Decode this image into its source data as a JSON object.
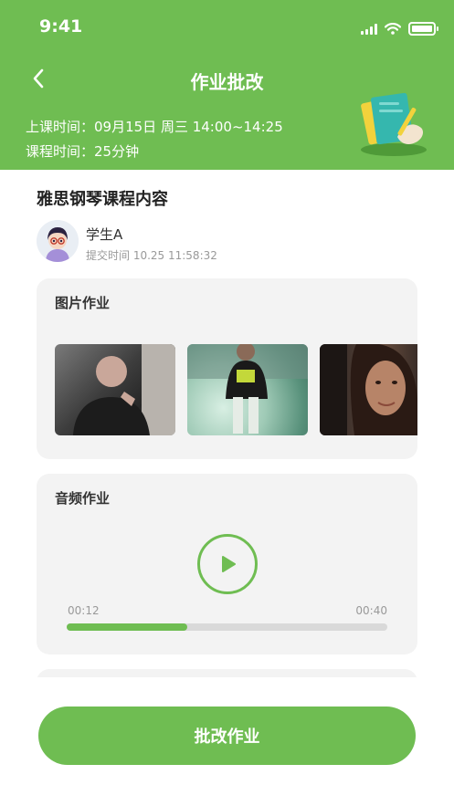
{
  "status_bar": {
    "time": "9:41"
  },
  "header": {
    "title": "作业批改",
    "class_time": "上课时间：09月15日 周三 14:00~14:25",
    "duration": "课程时间：25分钟"
  },
  "course": {
    "title": "雅思钢琴课程内容"
  },
  "student": {
    "name": "学生A",
    "submit_time": "提交时间 10.25 11:58:32"
  },
  "image_homework": {
    "title": "图片作业",
    "image_count": 3
  },
  "audio_homework": {
    "title": "音频作业",
    "current_time": "00:12",
    "total_time": "00:40",
    "progress": 0.375
  },
  "action": {
    "label": "批改作业"
  },
  "colors": {
    "accent": "#6fbd52",
    "card_bg": "#f3f3f3",
    "muted_text": "#999999"
  },
  "icons": [
    "back-arrow-icon",
    "signal-icon",
    "wifi-icon",
    "battery-icon",
    "play-icon",
    "homework-illustration"
  ]
}
